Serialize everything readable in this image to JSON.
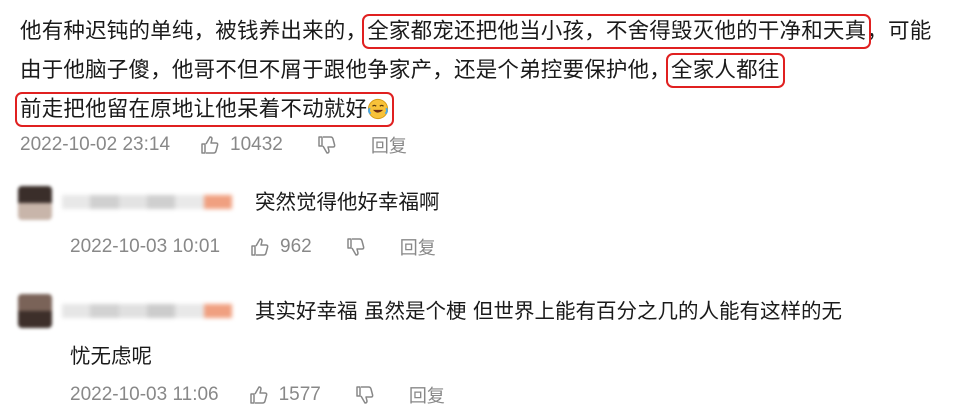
{
  "main_comment": {
    "seg1": "他有种迟钝的单纯，被钱养出来的，",
    "hl1": "全家都宠还把他当小孩，不舍得毁灭他的干净和天真",
    "seg2": "，可能由于他脑子傻，他哥不但不屑于跟他争家产，还是个弟控要保护他，",
    "hl2a": "全家人都往",
    "hl2b": "前走把他留在原地让他呆着不动就好",
    "emoji": "crying-laughing-emoji",
    "timestamp": "2022-10-02 23:14",
    "likes": "10432",
    "reply_label": "回复"
  },
  "replies": [
    {
      "text": "突然觉得他好幸福啊",
      "timestamp": "2022-10-03 10:01",
      "likes": "962",
      "reply_label": "回复"
    },
    {
      "text_line1": "其实好幸福 虽然是个梗 但世界上能有百分之几的人能有这样的无",
      "text_line2": "忧无虑呢",
      "timestamp": "2022-10-03 11:06",
      "likes": "1577",
      "reply_label": "回复"
    }
  ],
  "colors": {
    "highlight_box": "#e02020",
    "meta_text": "#888888",
    "body_text": "#1a1a1a"
  }
}
